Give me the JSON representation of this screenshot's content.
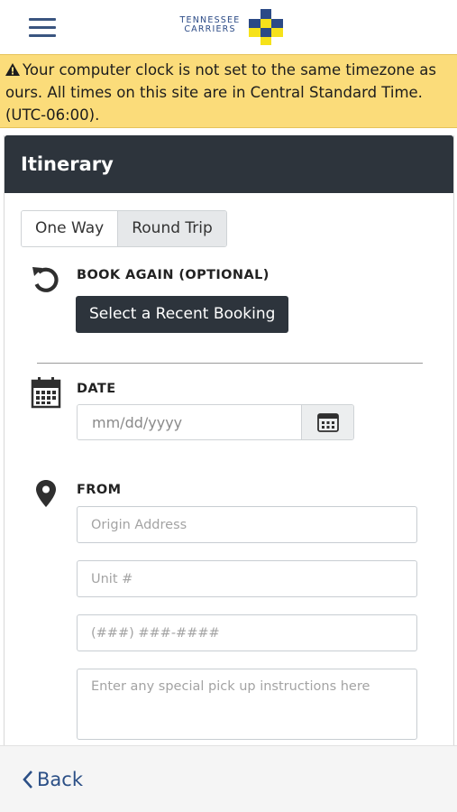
{
  "header": {
    "logo_text_line1": "TENNESSEE",
    "logo_text_line2": "CARRIERS",
    "menu_icon": "hamburger-menu-icon"
  },
  "banner": {
    "icon": "warning-icon",
    "message": "Your computer clock is not set to the same timezone as ours. All times on this site are in Central Standard Time. (UTC-06:00).",
    "bg_color": "#fbdc7a"
  },
  "itinerary": {
    "title": "Itinerary",
    "trip_type": {
      "options": [
        "One Way",
        "Round Trip"
      ],
      "selected": "Round Trip"
    },
    "book_again": {
      "label": "BOOK AGAIN (OPTIONAL)",
      "button_label": "Select a Recent Booking",
      "icon": "undo-icon"
    },
    "date": {
      "label": "DATE",
      "placeholder": "mm/dd/yyyy",
      "icon": "calendar-icon"
    },
    "from": {
      "label": "FROM",
      "icon": "map-marker-icon",
      "origin_placeholder": "Origin Address",
      "unit_placeholder": "Unit #",
      "phone_placeholder": "(###) ###-####",
      "instructions_placeholder": "Enter any special pick up instructions here"
    }
  },
  "footer": {
    "back_label": "Back",
    "back_icon": "chevron-left-icon"
  },
  "colors": {
    "header_dark": "#2d343c",
    "brand_blue": "#2b4a86",
    "logo_yellow": "#f6e21a"
  }
}
